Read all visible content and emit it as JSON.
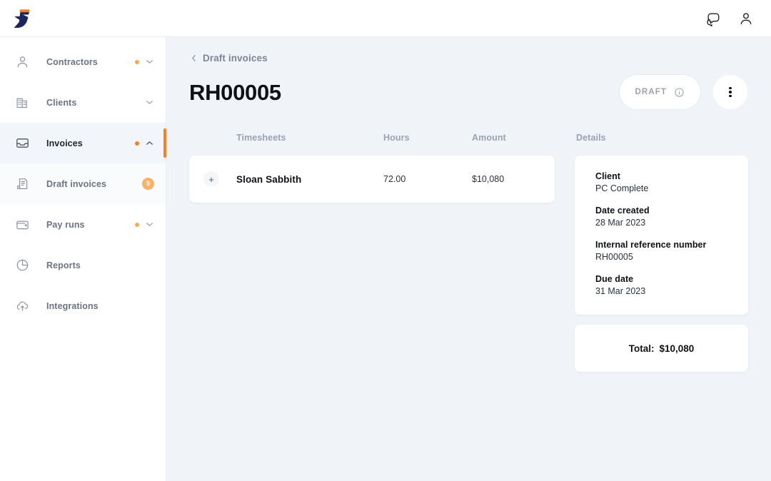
{
  "topbar": {
    "logo_name": "brand-logo",
    "icons": [
      {
        "name": "messages-icon",
        "label": "Messages"
      },
      {
        "name": "account-icon",
        "label": "Account"
      }
    ]
  },
  "sidebar": {
    "items": [
      {
        "label": "Contractors",
        "icon": "person-icon",
        "active": false,
        "sub": false,
        "dot": true,
        "chevron": "down",
        "badge": null
      },
      {
        "label": "Clients",
        "icon": "building-icon",
        "active": false,
        "sub": false,
        "dot": false,
        "chevron": "down",
        "badge": null
      },
      {
        "label": "Invoices",
        "icon": "inbox-tray-icon",
        "active": true,
        "sub": false,
        "dot": true,
        "chevron": "up",
        "badge": null
      },
      {
        "label": "Draft invoices",
        "icon": "document-icon",
        "active": false,
        "sub": true,
        "dot": false,
        "chevron": null,
        "badge": "5"
      },
      {
        "label": "Pay runs",
        "icon": "wallet-icon",
        "active": false,
        "sub": false,
        "dot": true,
        "chevron": "down",
        "badge": null
      },
      {
        "label": "Reports",
        "icon": "pie-chart-icon",
        "active": false,
        "sub": false,
        "dot": false,
        "chevron": null,
        "badge": null
      },
      {
        "label": "Integrations",
        "icon": "cloud-upload-icon",
        "active": false,
        "sub": false,
        "dot": false,
        "chevron": null,
        "badge": null
      }
    ]
  },
  "page": {
    "breadcrumb": "Draft invoices",
    "title": "RH00005",
    "status": "DRAFT",
    "status_info_icon": "info-icon",
    "kebab_icon": "more-vertical-icon"
  },
  "table": {
    "columns": {
      "timesheets": "Timesheets",
      "hours": "Hours",
      "amount": "Amount"
    },
    "rows": [
      {
        "expand": "+",
        "name": "Sloan Sabbith",
        "hours": "72.00",
        "amount": "$10,080"
      }
    ]
  },
  "details": {
    "heading": "Details",
    "fields": [
      {
        "key": "Client",
        "value": "PC Complete"
      },
      {
        "key": "Date created",
        "value": "28 Mar 2023"
      },
      {
        "key": "Internal reference number",
        "value": "RH00005"
      },
      {
        "key": "Due date",
        "value": "31 Mar 2023"
      }
    ],
    "total_label": "Total:",
    "total_value": "$10,080"
  },
  "colors": {
    "accent": "#f58220",
    "badge": "#f7b267",
    "page_bg": "#f0f3f7",
    "surface": "#ffffff",
    "text": "#0e1116",
    "muted": "#9aa2b4"
  }
}
